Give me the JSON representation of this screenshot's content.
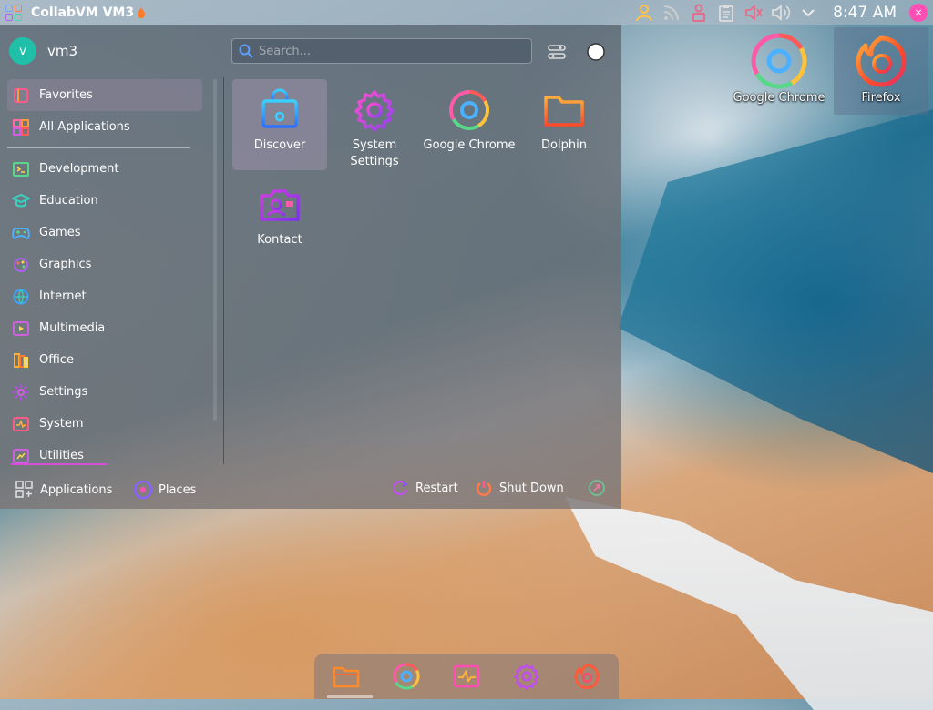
{
  "top_panel": {
    "title": "CollabVM VM3",
    "clock": "8:47 AM",
    "tray_icons": [
      "user-icon",
      "rss-icon",
      "user-lock-icon",
      "clipboard-icon",
      "microphone-muted-icon",
      "volume-icon",
      "chevron-down-icon"
    ]
  },
  "launcher": {
    "user": {
      "initial": "v",
      "name": "vm3"
    },
    "search": {
      "placeholder": "Search...",
      "value": ""
    },
    "sidebar": {
      "items": [
        {
          "label": "Favorites",
          "icon": "favorites-icon",
          "active": true
        },
        {
          "label": "All Applications",
          "icon": "all-applications-icon"
        },
        {
          "label": "Development",
          "icon": "development-icon"
        },
        {
          "label": "Education",
          "icon": "education-icon"
        },
        {
          "label": "Games",
          "icon": "games-icon"
        },
        {
          "label": "Graphics",
          "icon": "graphics-icon"
        },
        {
          "label": "Internet",
          "icon": "internet-icon"
        },
        {
          "label": "Multimedia",
          "icon": "multimedia-icon"
        },
        {
          "label": "Office",
          "icon": "office-icon"
        },
        {
          "label": "Settings",
          "icon": "settings-icon"
        },
        {
          "label": "System",
          "icon": "system-icon"
        },
        {
          "label": "Utilities",
          "icon": "utilities-icon"
        }
      ]
    },
    "apps": [
      {
        "label": "Discover",
        "icon": "discover-icon",
        "active": true
      },
      {
        "label": "System Settings",
        "icon": "system-settings-icon"
      },
      {
        "label": "Google Chrome",
        "icon": "chrome-icon"
      },
      {
        "label": "Dolphin",
        "icon": "dolphin-icon"
      },
      {
        "label": "Kontact",
        "icon": "kontact-icon"
      }
    ],
    "footer": {
      "applications": "Applications",
      "places": "Places",
      "restart": "Restart",
      "shutdown": "Shut Down"
    }
  },
  "desktop": {
    "icons": [
      {
        "label": "Google Chrome",
        "icon": "chrome-icon"
      },
      {
        "label": "Firefox",
        "icon": "firefox-icon",
        "selected": true
      }
    ]
  },
  "dock": {
    "items": [
      "dolphin-icon",
      "chrome-icon",
      "system-monitor-icon",
      "system-settings-icon",
      "firefox-icon"
    ]
  }
}
